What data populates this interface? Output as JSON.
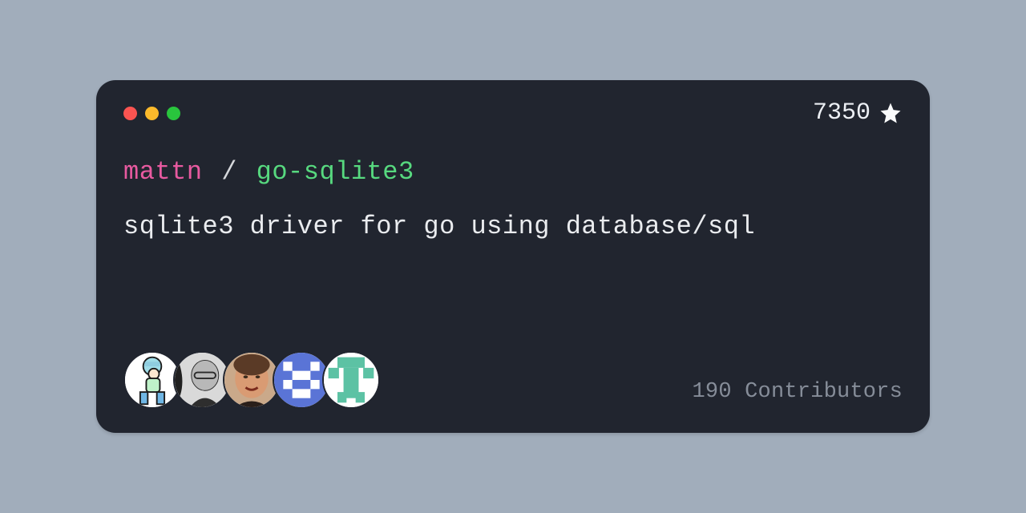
{
  "window": {
    "stars_count": "7350"
  },
  "repository": {
    "owner": "mattn",
    "separator": "/",
    "name": "go-sqlite3",
    "description": "sqlite3 driver for go using database/sql"
  },
  "contributors": {
    "count": "190",
    "label_suffix": "Contributors",
    "avatars": [
      {
        "name": "avatar-1"
      },
      {
        "name": "avatar-2"
      },
      {
        "name": "avatar-3"
      },
      {
        "name": "avatar-4"
      },
      {
        "name": "avatar-5"
      }
    ]
  }
}
